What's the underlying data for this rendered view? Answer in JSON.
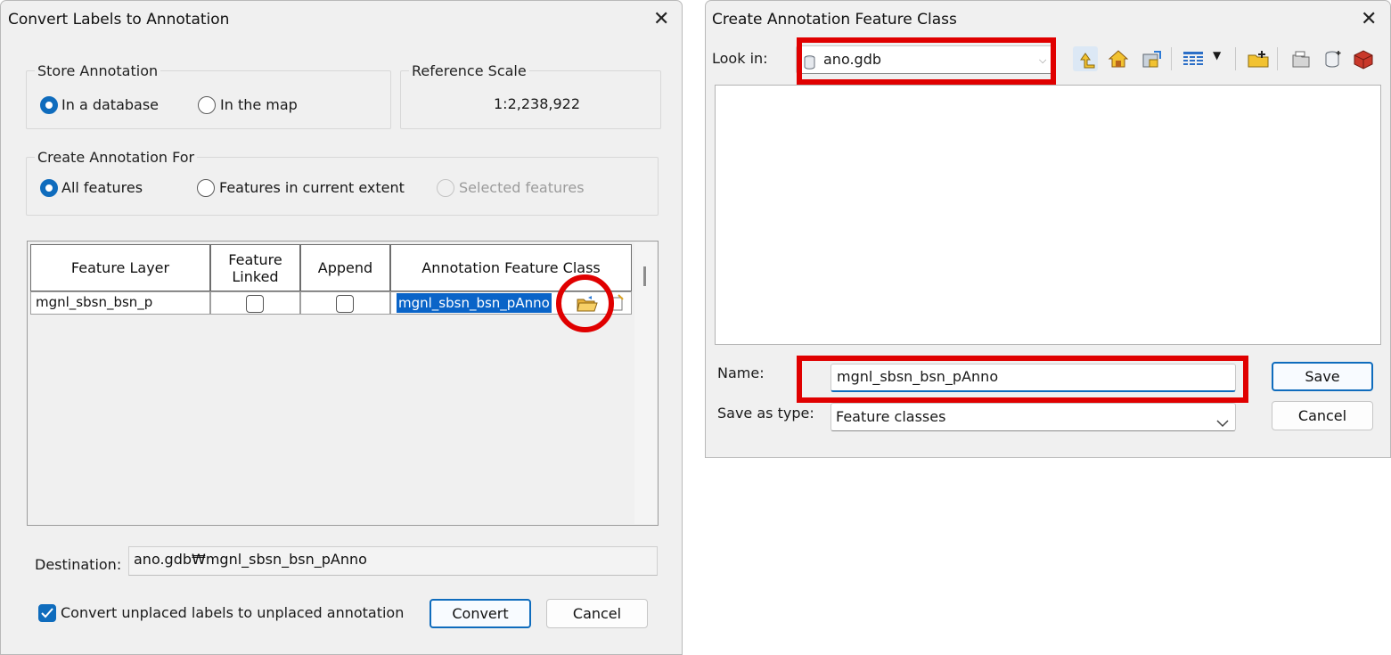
{
  "convert_dialog": {
    "title": "Convert Labels to Annotation",
    "store_annotation": {
      "legend": "Store Annotation",
      "options": [
        "In a database",
        "In the map"
      ],
      "selected": "In a database"
    },
    "reference_scale": {
      "legend": "Reference Scale",
      "value": "1:2,238,922"
    },
    "create_for": {
      "legend": "Create Annotation For",
      "options": [
        "All features",
        "Features in current extent",
        "Selected features"
      ],
      "selected": "All features",
      "disabled": [
        "Selected features"
      ]
    },
    "table": {
      "columns": [
        "Feature Layer",
        "Feature\nLinked",
        "Append",
        "Annotation Feature Class"
      ],
      "rows": [
        {
          "feature_layer": "mgnl_sbsn_bsn_p",
          "feature_linked": false,
          "append": false,
          "annotation_feature_class": "mgnl_sbsn_bsn_pAnno"
        }
      ],
      "row_icons": [
        "folder-open-icon",
        "properties-icon"
      ]
    },
    "destination": {
      "label": "Destination:",
      "value": "ano.gdb₩mgnl_sbsn_bsn_pAnno"
    },
    "convert_unplaced": {
      "label": "Convert unplaced labels to unplaced annotation",
      "checked": true
    },
    "buttons": {
      "convert": "Convert",
      "cancel": "Cancel"
    }
  },
  "create_dialog": {
    "title": "Create Annotation Feature Class",
    "look_in_label": "Look in:",
    "look_in_value": "ano.gdb",
    "toolbar_icons": [
      "up-one-level-icon",
      "home-icon",
      "connect-folder-icon",
      "view-menu-icon",
      "new-folder-icon",
      "new-file-gdb-icon",
      "new-database-icon",
      "new-toolbox-icon"
    ],
    "name_label": "Name:",
    "name_value": "mgnl_sbsn_bsn_pAnno",
    "save_as_type_label": "Save as type:",
    "save_as_type_value": "Feature classes",
    "buttons": {
      "save": "Save",
      "cancel": "Cancel"
    }
  },
  "colors": {
    "accent": "#0f6cbd",
    "highlight": "#e00000",
    "selection": "#0a64c8"
  }
}
